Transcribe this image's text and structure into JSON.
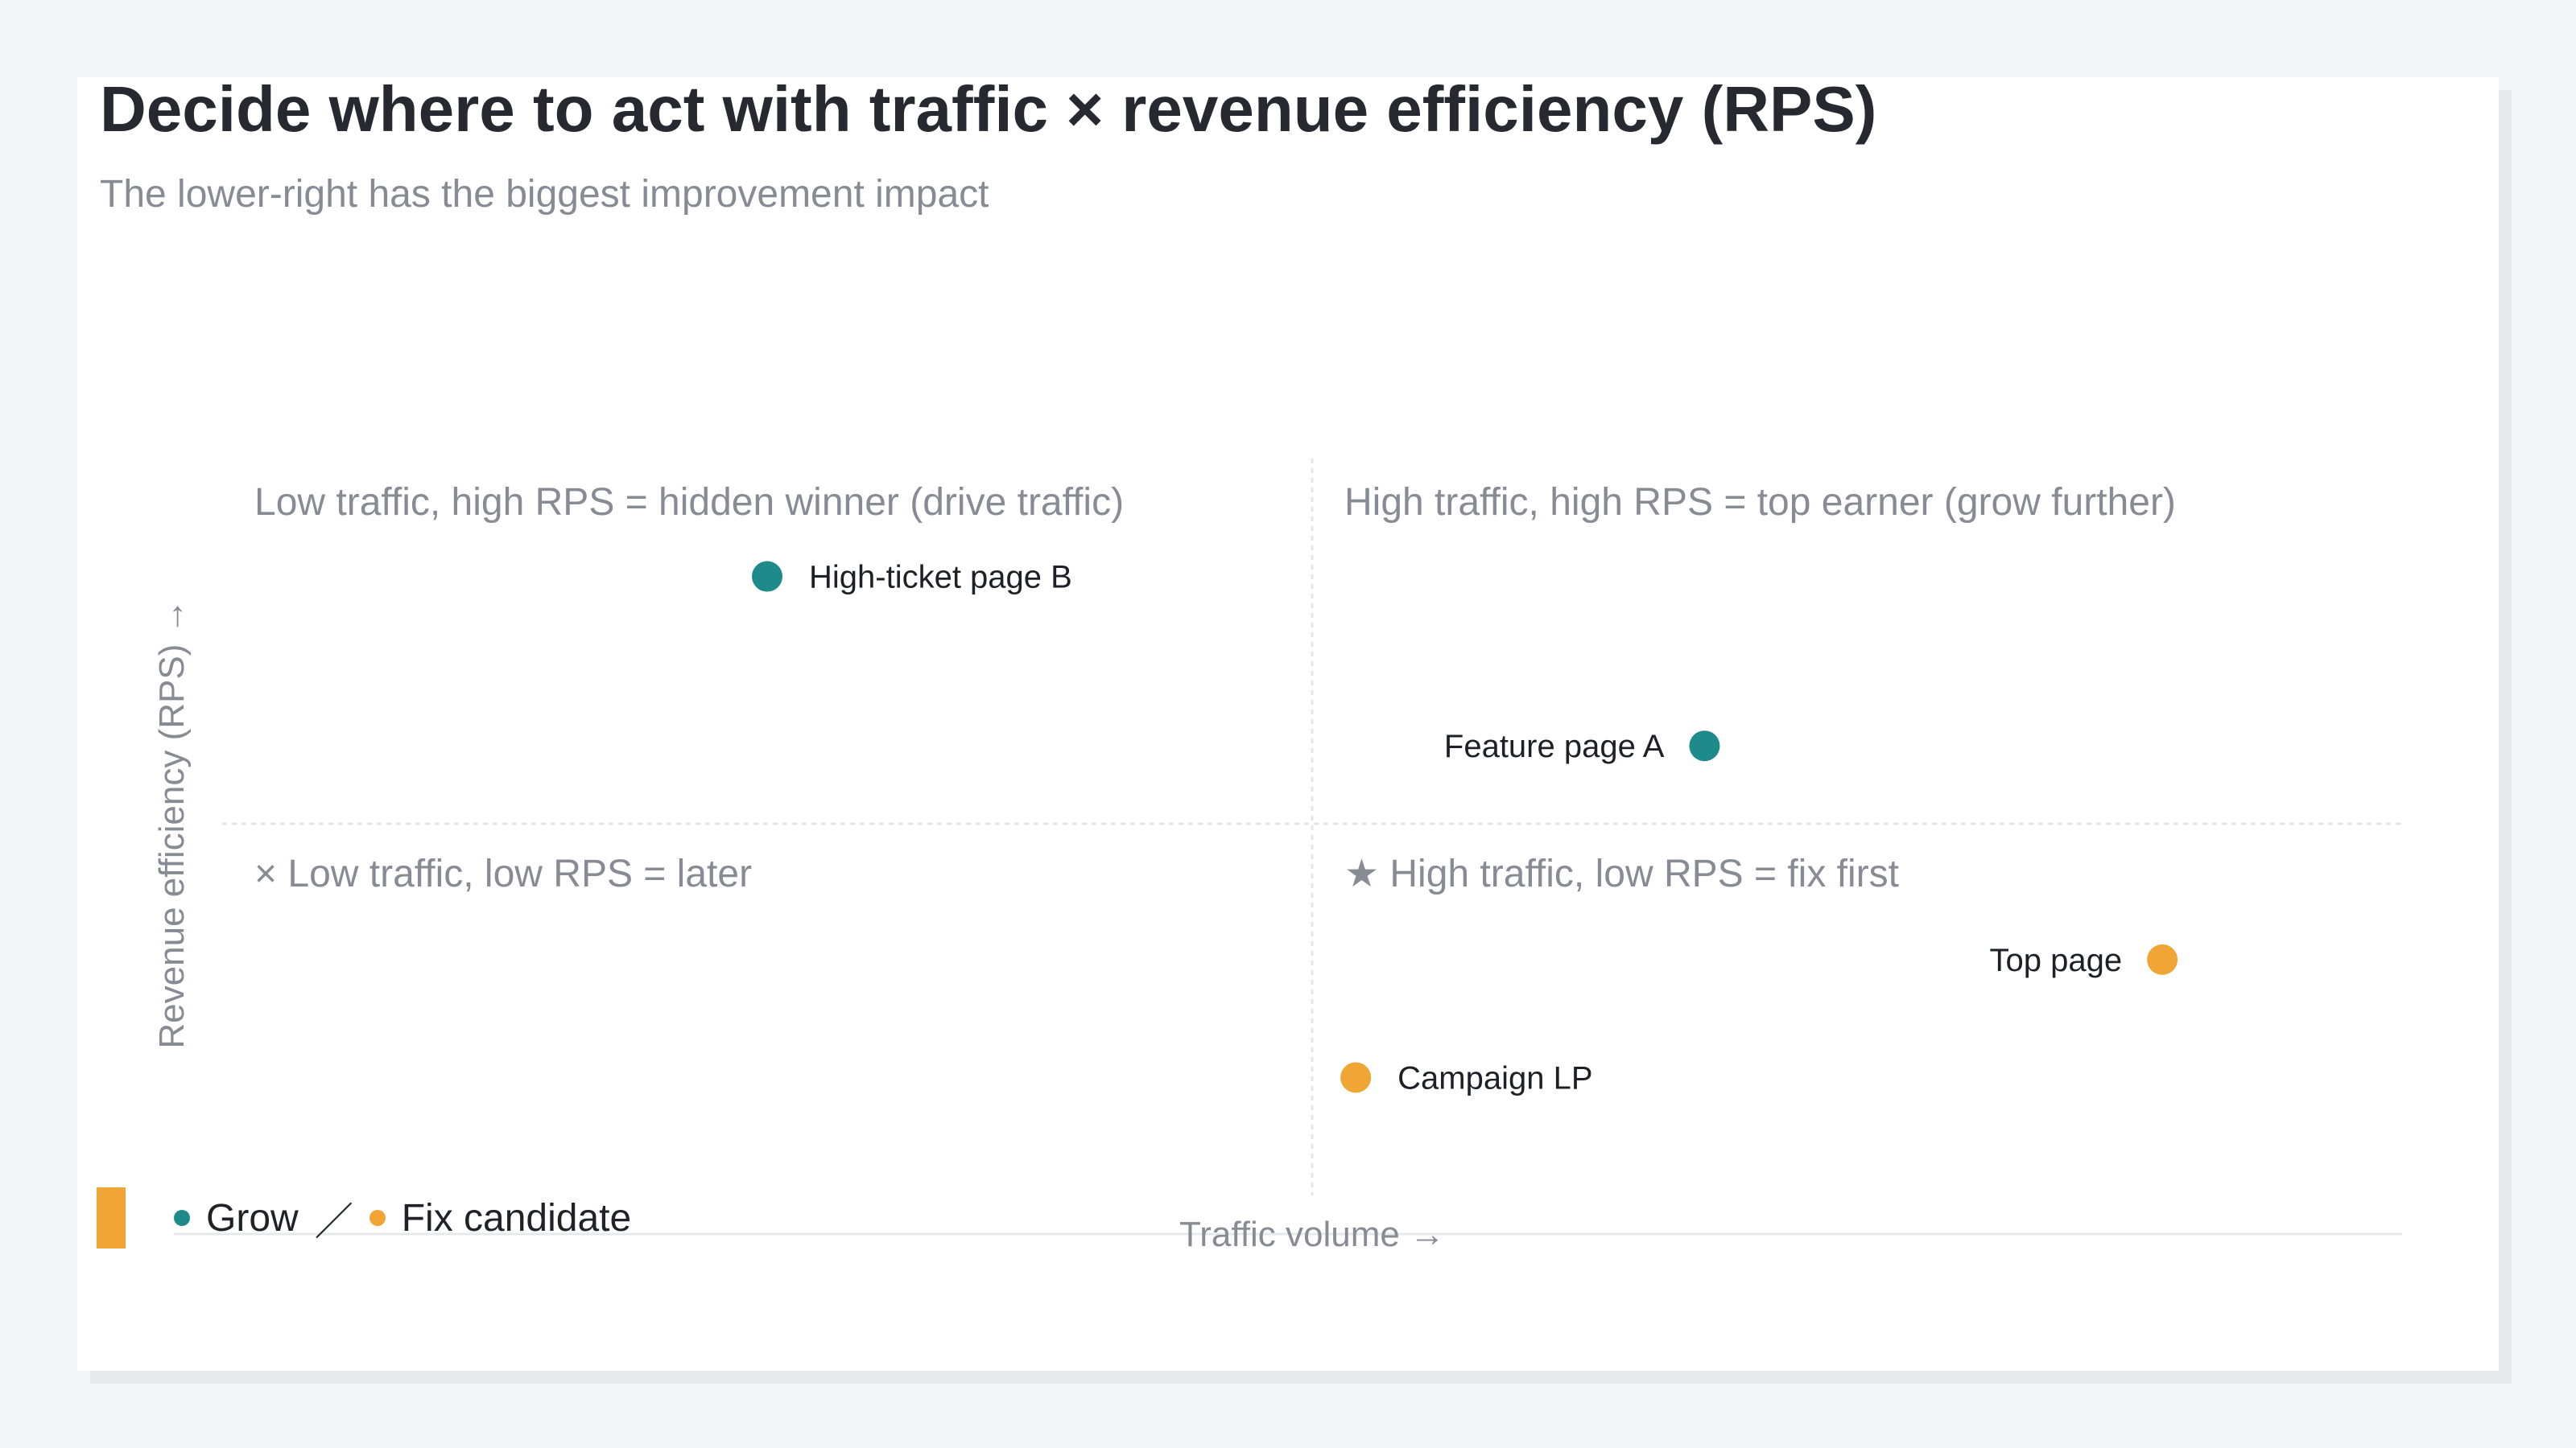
{
  "title": "Decide where to act with traffic × revenue efficiency (RPS)",
  "subtitle": "The lower-right has the biggest improvement impact",
  "chart_data": {
    "type": "scatter",
    "xlabel": "Traffic volume →",
    "ylabel": "Revenue efficiency (RPS) →",
    "xlim": [
      0,
      100
    ],
    "ylim": [
      0,
      100
    ],
    "grid": false,
    "quadrants": {
      "top_left": "Low traffic, high RPS = hidden winner (drive traffic)",
      "top_right": "High traffic, high RPS = top earner (grow further)",
      "bottom_left": "× Low traffic, low RPS = later",
      "bottom_right": "★ High traffic, low RPS = fix first"
    },
    "points": [
      {
        "label": "High-ticket page B",
        "x": 25,
        "y": 84,
        "group": "Grow"
      },
      {
        "label": "Feature page A",
        "x": 68,
        "y": 61,
        "group": "Grow"
      },
      {
        "label": "Top page",
        "x": 89,
        "y": 32,
        "group": "Fix candidate"
      },
      {
        "label": "Campaign LP",
        "x": 52,
        "y": 16,
        "group": "Fix candidate"
      }
    ],
    "legend": {
      "position": "bottom-left",
      "items": [
        {
          "label": "Grow",
          "color": "#1f8a8a"
        },
        {
          "label": "Fix candidate",
          "color": "#f0a535"
        }
      ],
      "separator": "／"
    }
  }
}
